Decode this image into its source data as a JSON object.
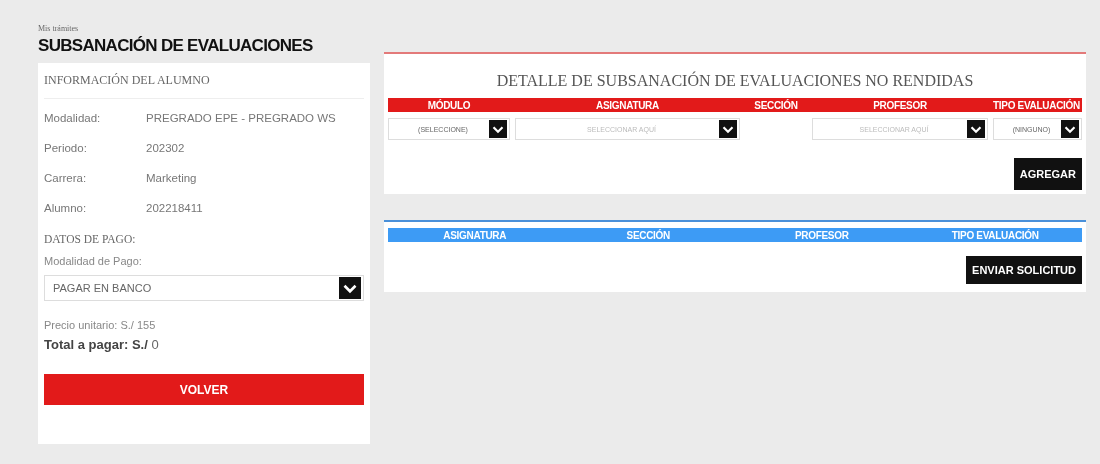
{
  "breadcrumb": "Mis trámites",
  "title": "SUBSANACIÓN DE EVALUACIONES",
  "student_card": {
    "heading": "INFORMACIÓN DEL ALUMNO",
    "fields": [
      {
        "label": "Modalidad:",
        "value": "PREGRADO EPE - PREGRADO WS"
      },
      {
        "label": "Periodo:",
        "value": "202302"
      },
      {
        "label": "Carrera:",
        "value": "Marketing"
      },
      {
        "label": "Alumno:",
        "value": "202218411"
      }
    ],
    "payment_heading": "DATOS DE PAGO:",
    "payment_mode_label": "Modalidad de Pago:",
    "payment_mode": {
      "value": "PAGAR EN BANCO"
    },
    "unit_price": "Precio unitario: S./ 155",
    "total": "**Total a pagar: S./** 0",
    "back_button": "VOLVER"
  },
  "detail_panel": {
    "title": "DETALLE DE SUBSANACIÓN DE EVALUACIONES NO RENDIDAS",
    "columns": [
      "MÓDULO",
      "ASIGNATURA",
      "SECCIÓN",
      "PROFESOR",
      "TIPO EVALUACIÓN"
    ],
    "inputs": [
      {
        "kind": "select",
        "value": "(SELECCIONE)"
      },
      {
        "kind": "select",
        "placeholder": "SELECCIONAR AQUÍ"
      },
      {
        "kind": "blank"
      },
      {
        "kind": "select",
        "placeholder": "SELECCIONAR AQUÍ"
      },
      {
        "kind": "select",
        "value": "(NINGUNO)"
      }
    ],
    "add_button": "AGREGAR"
  },
  "request_panel": {
    "columns": [
      "ASIGNATURA",
      "SECCIÓN",
      "PROFESOR",
      "TIPO EVALUACIÓN"
    ],
    "send_button": "ENVIAR SOLICITUD"
  }
}
